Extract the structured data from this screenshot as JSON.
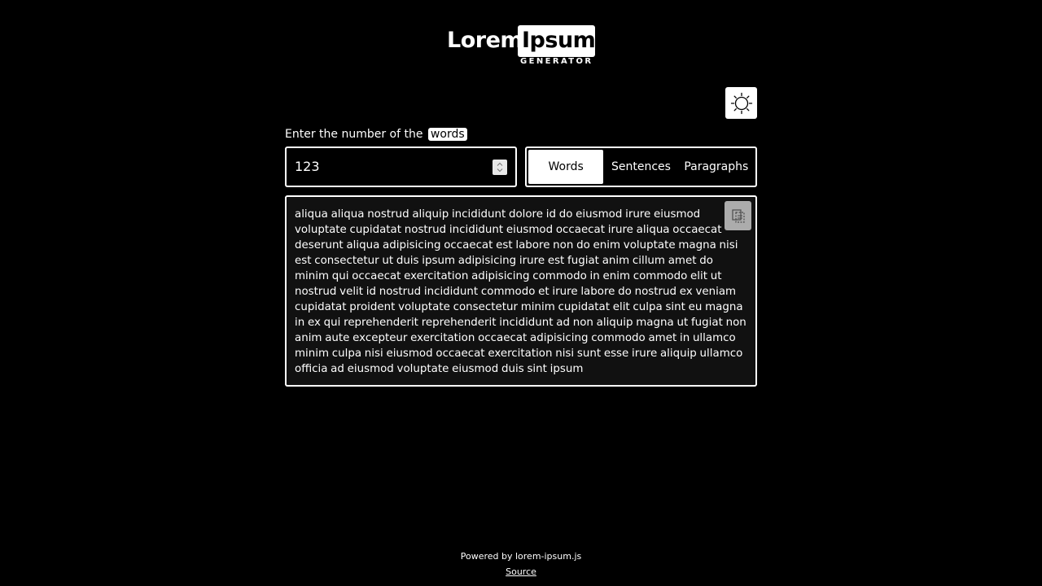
{
  "logo": {
    "lorem": "Lorem",
    "ipsum": "Ipsum",
    "generator": "GENERATOR"
  },
  "theme_toggle": {
    "icon": "sun-icon"
  },
  "count": {
    "label": "Enter the number of the",
    "unit": "words",
    "value": "123"
  },
  "modes": [
    {
      "label": "Words",
      "active": true
    },
    {
      "label": "Sentences",
      "active": false
    },
    {
      "label": "Paragraphs",
      "active": false
    }
  ],
  "output": {
    "text": "aliqua aliqua nostrud aliquip incididunt dolore id do eiusmod irure eiusmod voluptate cupidatat nostrud incididunt eiusmod occaecat irure aliqua occaecat deserunt aliqua adipisicing occaecat est labore non do enim voluptate magna nisi est consectetur ut duis ipsum adipisicing irure est fugiat anim cillum amet do minim qui occaecat exercitation adipisicing commodo in enim commodo elit ut nostrud velit id nostrud incididunt commodo et irure labore do nostrud ex veniam cupidatat proident voluptate consectetur minim cupidatat elit culpa sint eu magna in ex qui reprehenderit reprehenderit incididunt ad non aliquip magna ut fugiat non anim aute excepteur exercitation occaecat adipisicing commodo amet in ullamco minim culpa nisi eiusmod occaecat exercitation nisi sunt esse irure aliquip ullamco officia ad eiusmod voluptate eiusmod duis sint ipsum",
    "copy_icon": "copy-icon"
  },
  "footer": {
    "powered": "Powered by lorem-ipsum.js",
    "source": "Source"
  }
}
